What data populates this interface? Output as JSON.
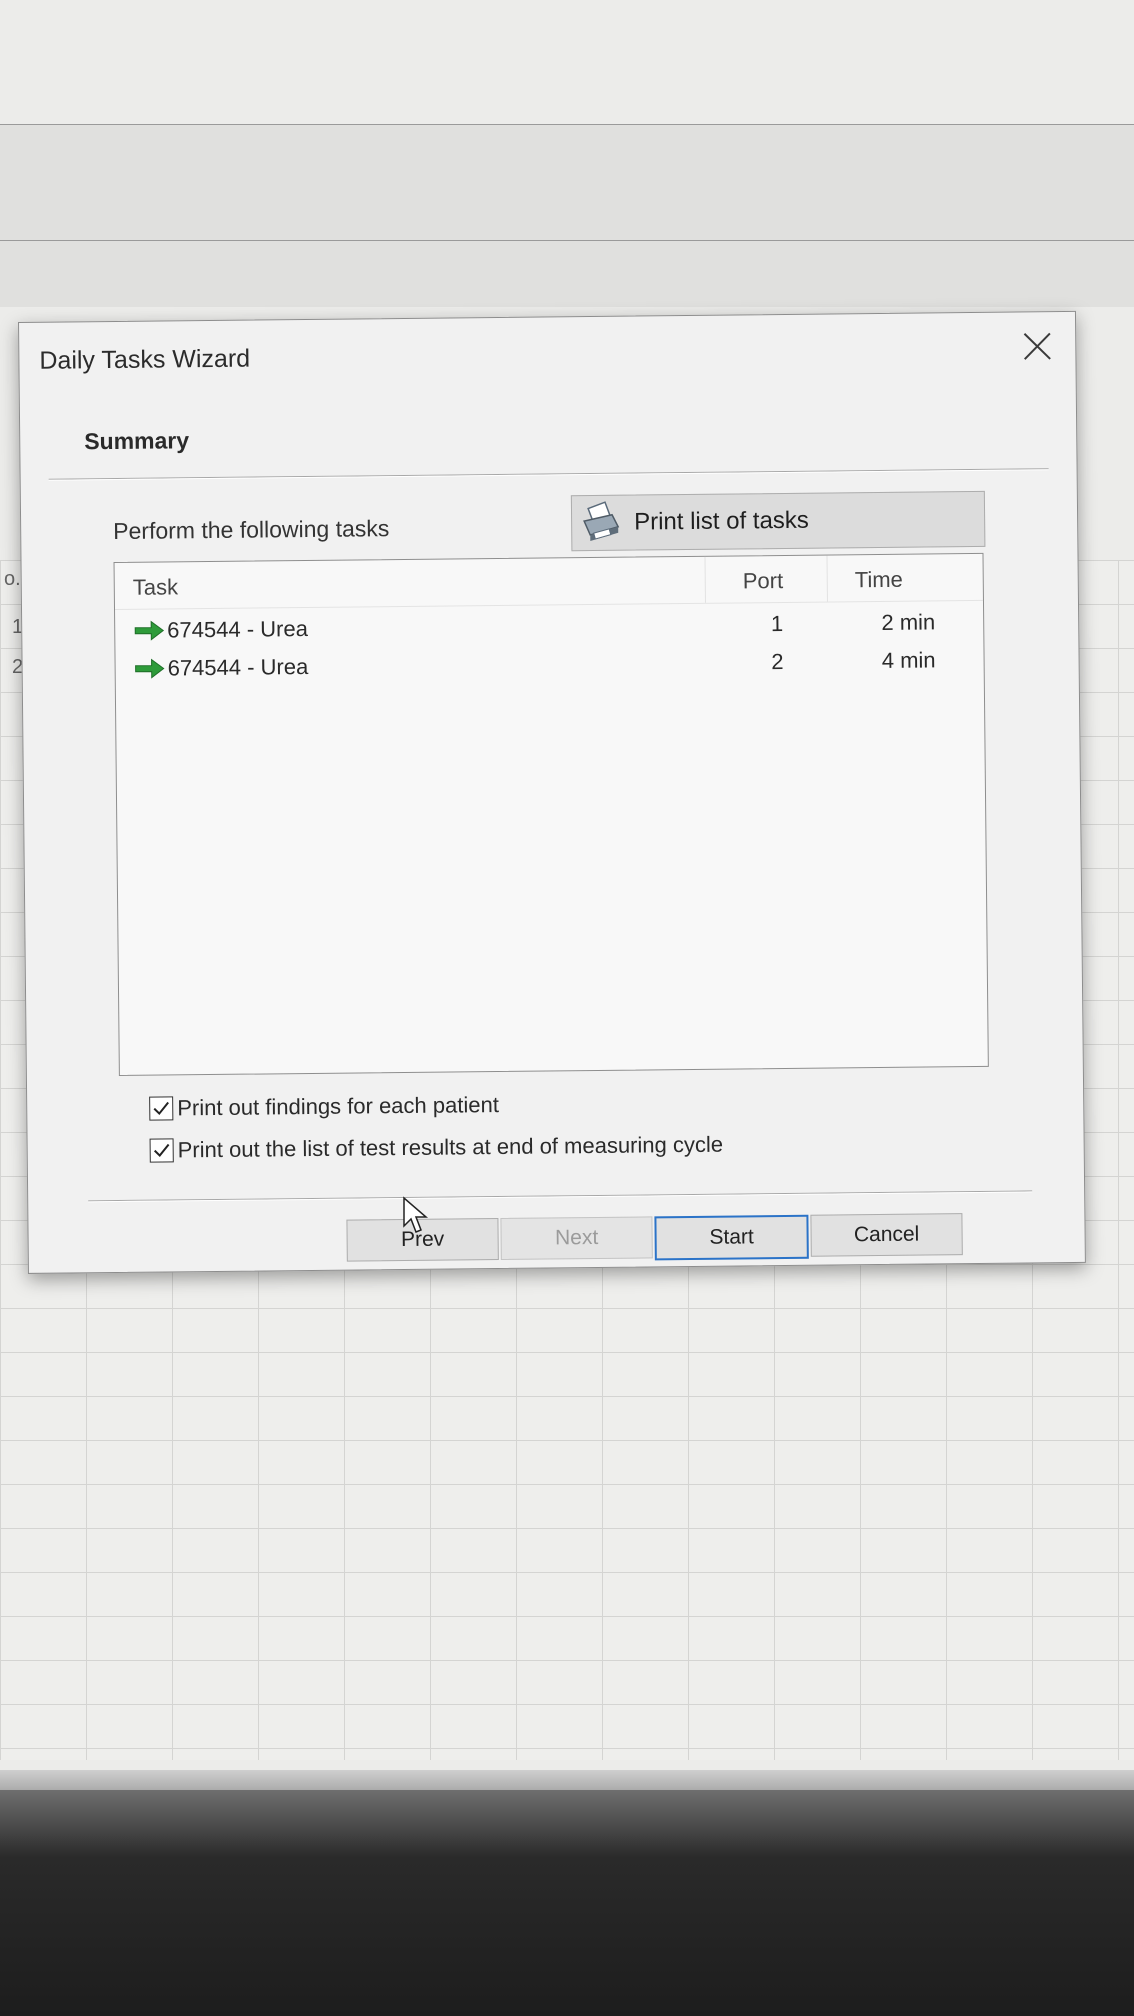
{
  "background": {
    "row_numbers": [
      "o.",
      "1",
      "2"
    ]
  },
  "dialog": {
    "title": "Daily Tasks Wizard",
    "section_title": "Summary",
    "instruction": "Perform the following tasks",
    "print_button_label": "Print list of tasks",
    "close_icon": "close-icon",
    "print_icon": "printer-icon"
  },
  "task_list": {
    "columns": {
      "task": "Task",
      "port": "Port",
      "time": "Time"
    },
    "rows": [
      {
        "icon": "green-arrow-icon",
        "task": "674544 - Urea",
        "port": "1",
        "time": "2 min"
      },
      {
        "icon": "green-arrow-icon",
        "task": "674544 - Urea",
        "port": "2",
        "time": "4 min"
      }
    ]
  },
  "options": {
    "print_findings": {
      "label": "Print out findings for each patient",
      "checked": true
    },
    "print_results": {
      "label": "Print out the list of test results at end of measuring cycle",
      "checked": true
    }
  },
  "buttons": {
    "prev": "Prev",
    "next": "Next",
    "start": "Start",
    "cancel": "Cancel",
    "next_enabled": false,
    "default_button": "Start"
  },
  "colors": {
    "arrow_green": "#2e9b3a",
    "default_button_border": "#2b73c8"
  }
}
